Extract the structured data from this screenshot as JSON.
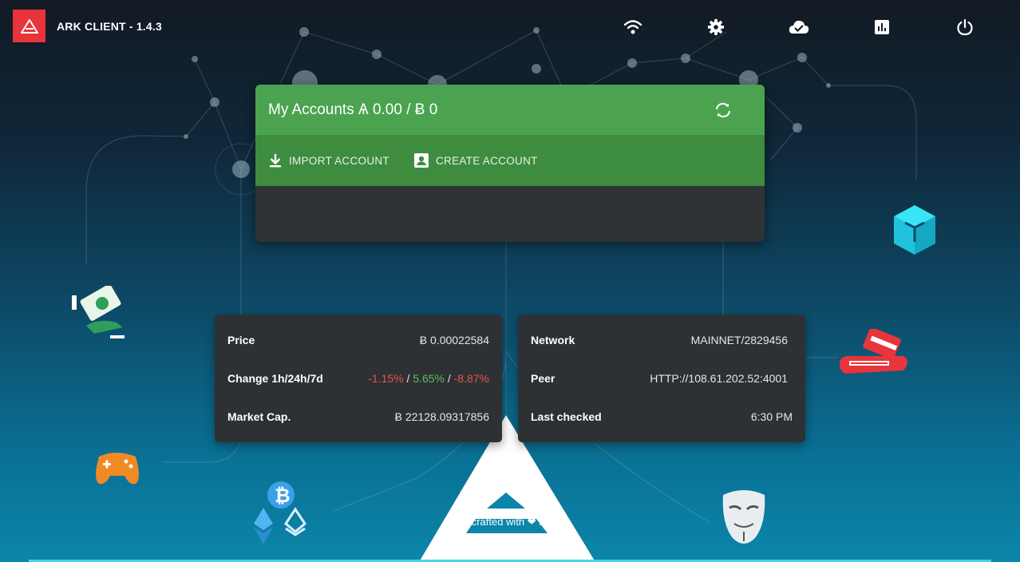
{
  "app": {
    "title": "ARK CLIENT - 1.4.3"
  },
  "toolbar": {
    "icons": [
      "wifi-icon",
      "settings-icon",
      "cloud-done-icon",
      "chart-icon",
      "power-icon"
    ]
  },
  "accounts": {
    "title": "My Accounts Ѧ 0.00 / Ƀ 0",
    "import_label": "IMPORT ACCOUNT",
    "create_label": "CREATE ACCOUNT"
  },
  "market": {
    "price_label": "Price",
    "price_value": "Ƀ 0.00022584",
    "change_label": "Change 1h/24h/7d",
    "change_1h": "-1.15%",
    "change_24h": "5.65%",
    "change_7d": "-8.87%",
    "sep": "/",
    "cap_label": "Market Cap.",
    "cap_value": "Ƀ 22128.09317856"
  },
  "network": {
    "network_label": "Network",
    "network_value": "MAINNET/2829456",
    "peer_label": "Peer",
    "peer_value": "HTTP://108.61.202.52:4001",
    "checked_label": "Last checked",
    "checked_value": "6:30 PM"
  },
  "footer": {
    "text": "Hand crafted with ❤ by Ark"
  },
  "colors": {
    "accent_red": "#e8343a",
    "green_header": "#4ba34f",
    "green_actions": "#3e8c3f",
    "card": "#2f3335"
  }
}
